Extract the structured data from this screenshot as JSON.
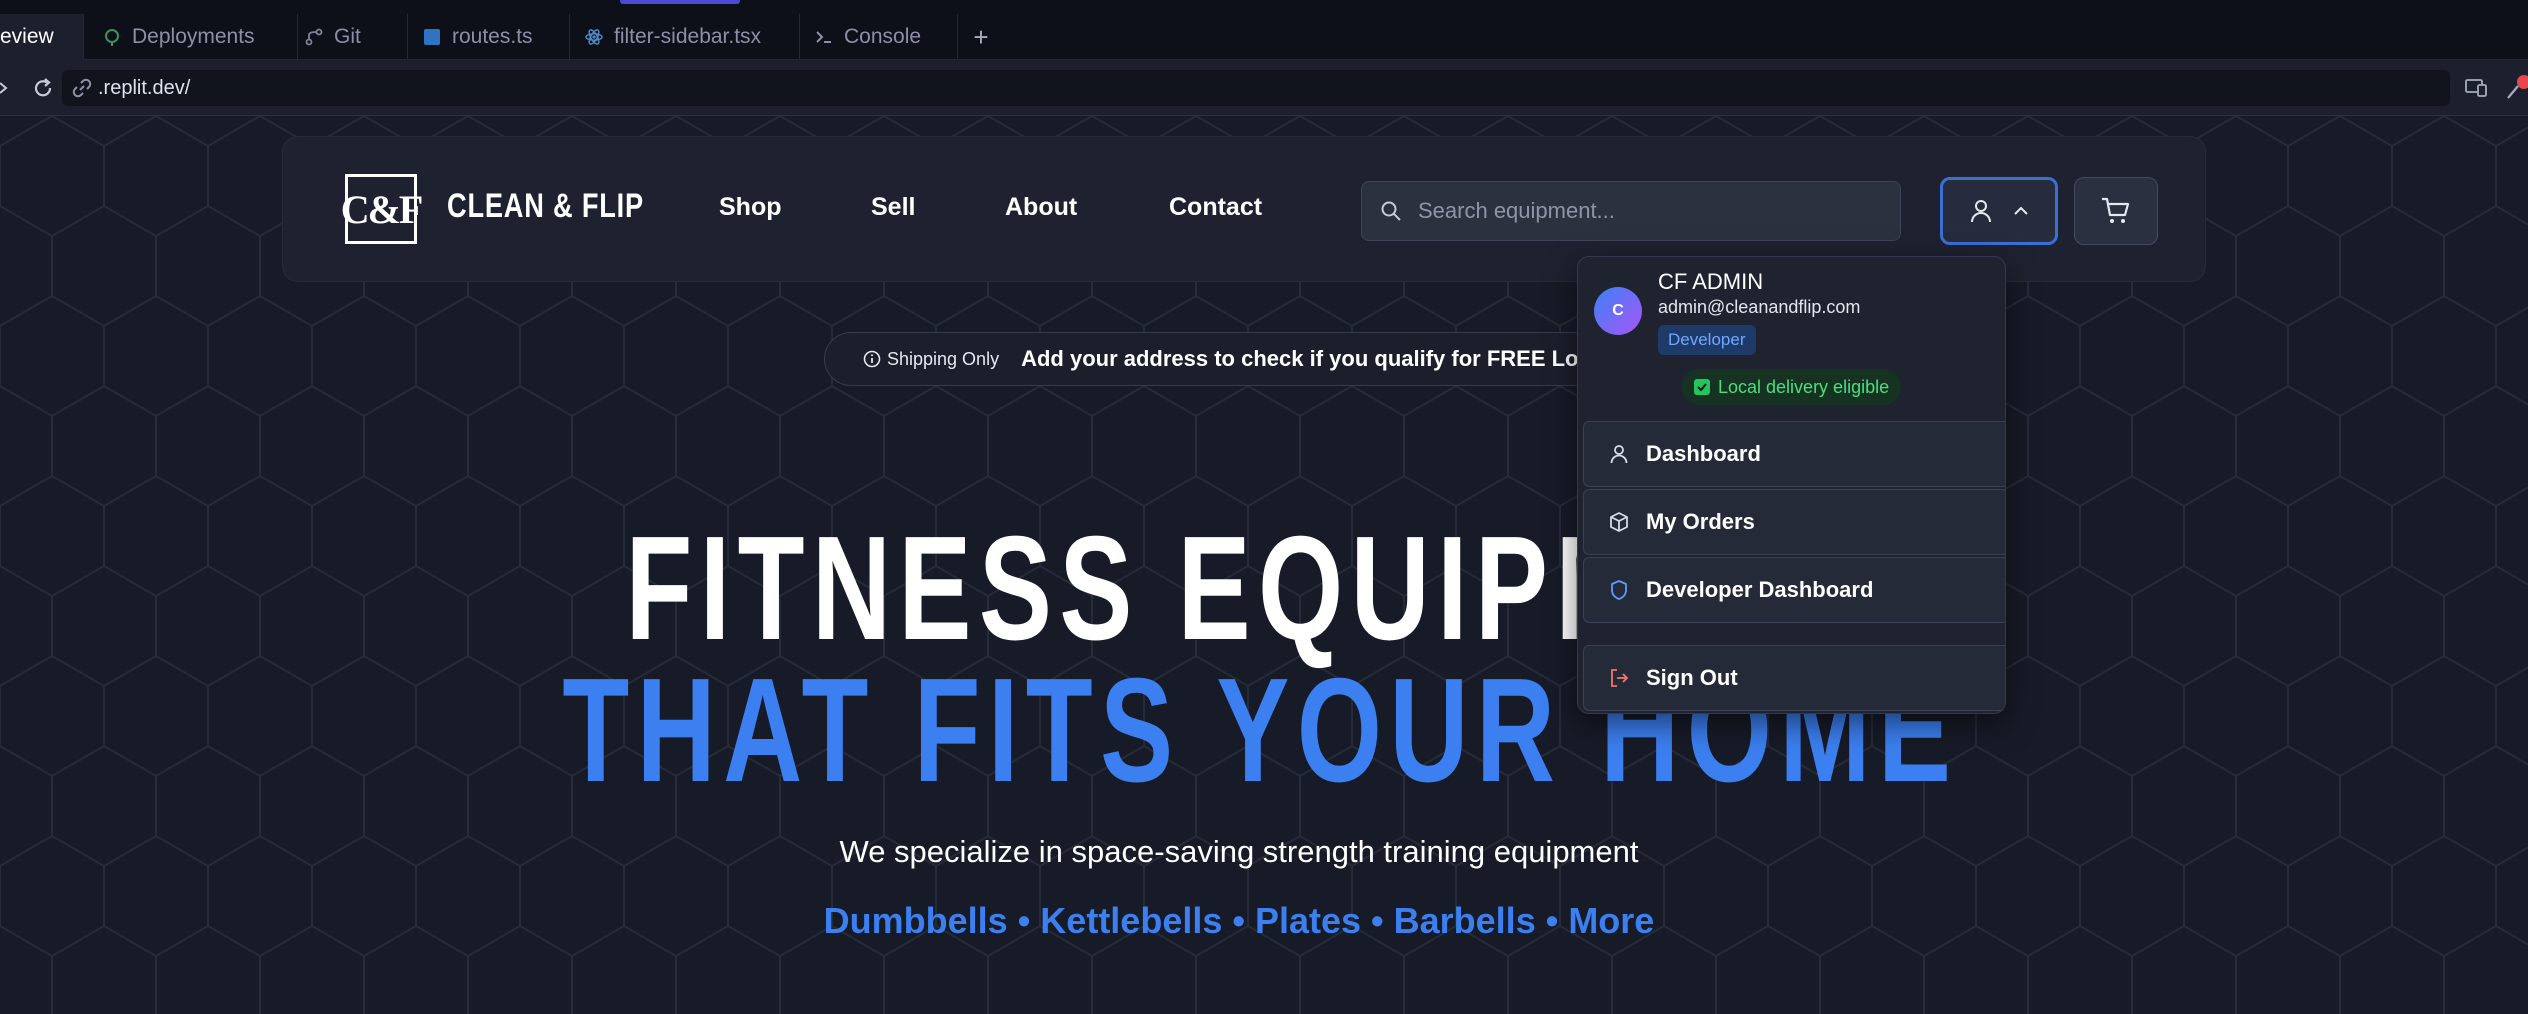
{
  "ide": {
    "tabs": [
      {
        "label": "eview",
        "icon": "preview-icon",
        "active": true
      },
      {
        "label": "Deployments",
        "icon": "deployments-icon"
      },
      {
        "label": "Git",
        "icon": "git-icon"
      },
      {
        "label": "routes.ts",
        "icon": "typescript-file-icon"
      },
      {
        "label": "filter-sidebar.tsx",
        "icon": "react-file-icon"
      },
      {
        "label": "Console",
        "icon": "terminal-icon"
      }
    ],
    "new_tab_label": "+",
    "url": ".replit.dev/"
  },
  "site": {
    "logo_text": "C&F",
    "brand": "CLEAN & FLIP",
    "nav_links": [
      "Shop",
      "Sell",
      "About",
      "Contact"
    ],
    "search_placeholder": "Search equipment...",
    "banner": {
      "badge": "Shipping Only",
      "message": "Add your address to check if you qualify for FREE Local Delivery"
    },
    "hero": {
      "line1": "FITNESS EQUIPMENT",
      "line2": "THAT FITS YOUR HOME",
      "subtitle": "We specialize in space-saving strength training equipment",
      "categories": "Dumbbells • Kettlebells • Plates • Barbells • More"
    }
  },
  "user_menu": {
    "avatar_initial": "C",
    "name": "CF ADMIN",
    "email": "admin@cleanandflip.com",
    "role": "Developer",
    "eligibility": "Local delivery eligible",
    "items": [
      {
        "label": "Dashboard",
        "icon": "user-icon"
      },
      {
        "label": "My Orders",
        "icon": "package-icon"
      },
      {
        "label": "Developer Dashboard",
        "icon": "shield-icon"
      },
      {
        "label": "Sign Out",
        "icon": "sign-out-icon"
      }
    ]
  },
  "colors": {
    "accent": "#3b7ff0",
    "background": "#171b27",
    "sign_out_icon": "#f87171",
    "eligible_green": "#4ade80"
  }
}
